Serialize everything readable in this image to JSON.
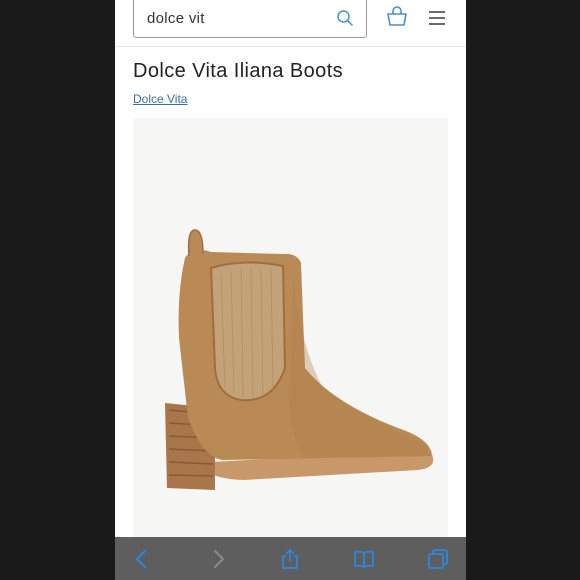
{
  "search": {
    "value": "dolce vit"
  },
  "product": {
    "title": "Dolce Vita Iliana Boots",
    "brand": "Dolce Vita"
  },
  "icons": {
    "search": "search-icon",
    "bag": "shopping-bag-icon",
    "menu": "hamburger-menu-icon",
    "back": "back-chevron-icon",
    "forward": "forward-chevron-icon",
    "share": "share-icon",
    "bookmarks": "bookmarks-icon",
    "tabs": "tabs-icon"
  },
  "colors": {
    "link": "#3a6fa0",
    "accent_icon": "#4a8fc6",
    "boot": "#b98a55",
    "browser_bar": "#5e5e5e",
    "browser_icon": "#2e86de"
  }
}
